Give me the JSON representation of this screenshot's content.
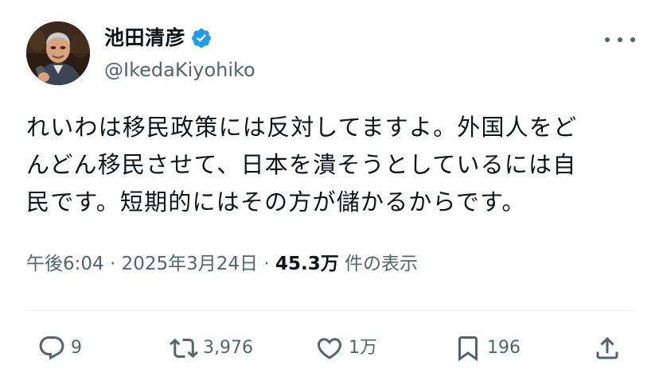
{
  "author": {
    "display_name": "池田清彦",
    "handle": "@IkedaKiyohiko",
    "verified": true,
    "verified_color": "#1d9bf0"
  },
  "tweet": {
    "lines": [
      "れいわは移民政策には反対してますよ。外国人をど",
      "んどん移民させて、日本を潰そうとしているには自",
      "民です。短期的にはその方が儲かるからです。"
    ]
  },
  "meta": {
    "time": "午後6:04",
    "sep1": " · ",
    "date": "2025年3月24日",
    "sep2": " · ",
    "views_count": "45.3万",
    "views_label": " 件の表示"
  },
  "actions": {
    "reply": {
      "icon": "reply-icon",
      "count": "9"
    },
    "retweet": {
      "icon": "retweet-icon",
      "count": "3,976"
    },
    "like": {
      "icon": "heart-icon",
      "count": "1万"
    },
    "bookmark": {
      "icon": "bookmark-icon",
      "count": "196"
    },
    "share": {
      "icon": "share-icon"
    }
  },
  "colors": {
    "text_primary": "#0f1419",
    "text_secondary": "#536471",
    "divider": "#eff3f4"
  }
}
